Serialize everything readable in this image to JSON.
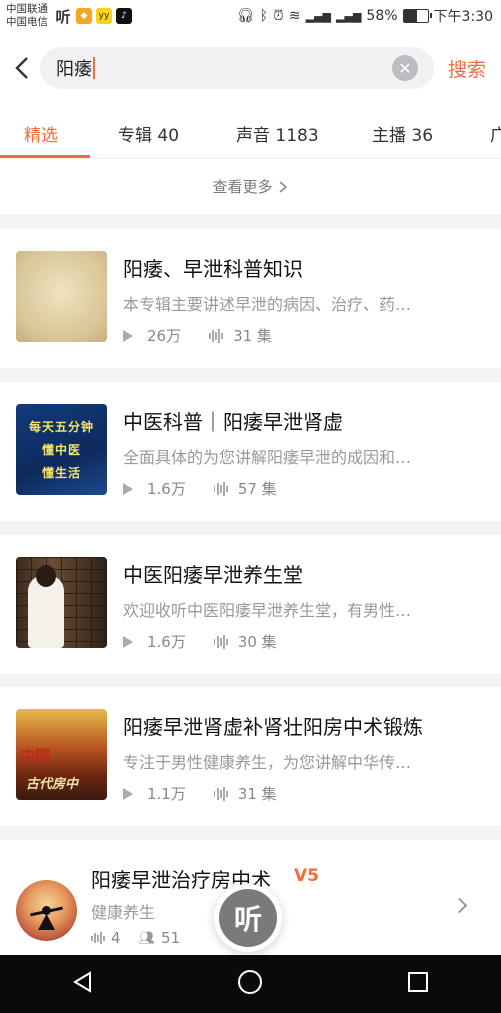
{
  "status_bar": {
    "carrier_1": "中国联通",
    "carrier_2": "中国电信",
    "app_icon_ting": "听",
    "battery_text": "58%",
    "time": "下午3:30",
    "battery_level": 0.58
  },
  "search": {
    "value": "阳痿",
    "search_label": "搜索"
  },
  "tabs": [
    {
      "label": "精选"
    },
    {
      "label": "专辑 40"
    },
    {
      "label": "声音 1183"
    },
    {
      "label": "主播 36"
    },
    {
      "label": "广"
    }
  ],
  "see_more_label": "查看更多",
  "albums": [
    {
      "title": "阳痿、早泄科普知识",
      "desc": "本专辑主要讲述早泄的病因、治疗、药…",
      "plays": "26万",
      "episodes": "31 集"
    },
    {
      "title": "中医科普｜阳痿早泄肾虚",
      "desc": "全面具体的为您讲解阳痿早泄的成因和…",
      "plays": "1.6万",
      "episodes": "57 集",
      "cover_text": [
        "每天五分钟",
        "懂中医",
        "懂生活"
      ]
    },
    {
      "title": "中医阳痿早泄养生堂",
      "desc": "欢迎收听中医阳痿早泄养生堂，有男性…",
      "plays": "1.6万",
      "episodes": "30 集"
    },
    {
      "title": "阳痿早泄肾虚补肾壮阳房中术锻炼",
      "desc": "专注于男性健康养生，为您讲解中华传…",
      "plays": "1.1万",
      "episodes": "31 集",
      "cover_text": [
        "中国",
        "古代房中"
      ]
    }
  ],
  "anchor": {
    "name": "阳痿早泄治疗房中术",
    "badge": "V5",
    "category": "健康养生",
    "tracks": "4",
    "followers": "51"
  },
  "float_button_label": "听",
  "colors": {
    "accent": "#f26b3a"
  }
}
